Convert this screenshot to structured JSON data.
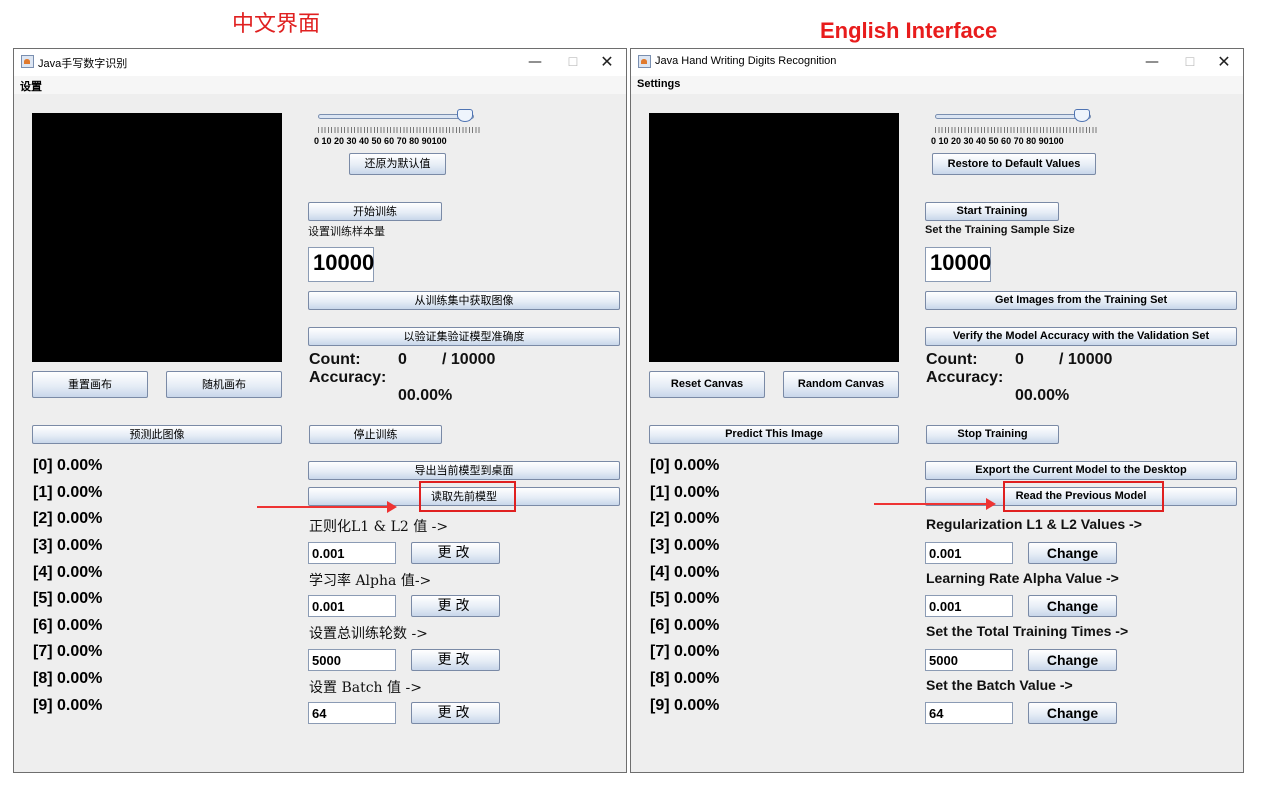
{
  "captions": {
    "zh": "中文界面",
    "en": "English Interface"
  },
  "zh": {
    "title": "Java手写数字识别",
    "menu": "设置",
    "slider_labels": "0  10 20 30 40 50 60 70 80 90100",
    "slider_value": 90,
    "restore": "还原为默认值",
    "start": "开始训练",
    "sample_label": "设置训练样本量",
    "sample_value": "10000",
    "get_images": "从训练集中获取图像",
    "verify": "以验证集验证模型准确度",
    "count_label": "Count:",
    "count_value": "0",
    "count_total": "/ 10000",
    "accuracy_label": "Accuracy:",
    "accuracy_value": "00.00%",
    "reset": "重置画布",
    "random": "随机画布",
    "predict": "预测此图像",
    "stop": "停止训练",
    "export": "导出当前模型到桌面",
    "read": "读取先前模型",
    "reg_label": "正则化L1 & L2 值 ->",
    "reg_value": "0.001",
    "lr_label": "学习率 Alpha 值->",
    "lr_value": "0.001",
    "epochs_label": "设置总训练轮数 ->",
    "epochs_value": "5000",
    "batch_label": "设置 Batch 值 ->",
    "batch_value": "64",
    "change": "更改",
    "probs": [
      "[0]  0.00%",
      "[1]  0.00%",
      "[2]  0.00%",
      "[3]  0.00%",
      "[4]  0.00%",
      "[5]  0.00%",
      "[6]  0.00%",
      "[7]  0.00%",
      "[8]  0.00%",
      "[9]  0.00%"
    ]
  },
  "en": {
    "title": "Java Hand Writing Digits Recognition",
    "menu": "Settings",
    "slider_labels": "0  10 20 30 40 50 60 70 80 90100",
    "slider_value": 90,
    "restore": "Restore to Default Values",
    "start": "Start Training",
    "sample_label": "Set the Training Sample Size",
    "sample_value": "10000",
    "get_images": "Get Images from the Training Set",
    "verify": "Verify the Model Accuracy with the Validation Set",
    "count_label": "Count:",
    "count_value": "0",
    "count_total": "/ 10000",
    "accuracy_label": "Accuracy:",
    "accuracy_value": "00.00%",
    "reset": "Reset Canvas",
    "random": "Random Canvas",
    "predict": "Predict This Image",
    "stop": "Stop Training",
    "export": "Export the Current Model to the Desktop",
    "read": "Read the Previous Model",
    "reg_label": "Regularization L1 & L2 Values ->",
    "reg_value": "0.001",
    "lr_label": "Learning Rate Alpha Value ->",
    "lr_value": "0.001",
    "epochs_label": "Set the Total Training Times ->",
    "epochs_value": "5000",
    "batch_label": "Set the Batch Value ->",
    "batch_value": "64",
    "change": "Change",
    "probs": [
      "[0]  0.00%",
      "[1]  0.00%",
      "[2]  0.00%",
      "[3]  0.00%",
      "[4]  0.00%",
      "[5]  0.00%",
      "[6]  0.00%",
      "[7]  0.00%",
      "[8]  0.00%",
      "[9]  0.00%"
    ]
  },
  "window_icons": {
    "app": "java-cup-icon",
    "minimize": "minimize-icon",
    "maximize": "maximize-icon",
    "close": "close-icon"
  },
  "colors": {
    "highlight": "#e02020",
    "canvas": "#000000",
    "window_bg": "#eeeeee"
  }
}
